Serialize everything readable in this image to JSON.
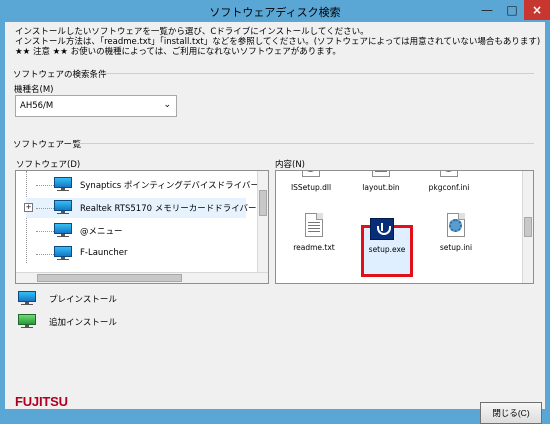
{
  "window": {
    "title": "ソフトウェアディスク検索",
    "minimize_icon": "—",
    "maximize_icon": "□",
    "close_icon": "×"
  },
  "intro": {
    "line1": "インストールしたいソフトウェアを一覧から選び、Cドライブにインストールしてください。",
    "line2": "インストール方法は、「readme.txt」「install.txt」などを参照してください。(ソフトウェアによっては用意されていない場合もあります)",
    "line3": "★★ 注意 ★★ お使いの機種によっては、ご利用になれないソフトウェアがあります。"
  },
  "search": {
    "group_title": "ソフトウェアの検索条件",
    "model_label": "機種名(M)",
    "model_value": "AH56/M",
    "dropdown_icon": "⌄"
  },
  "software": {
    "group_title": "ソフトウェア一覧",
    "list_label": "ソフトウェア(D)",
    "expand_icon": "+",
    "items": [
      {
        "label": "Synaptics ポインティングデバイスドライバー"
      },
      {
        "label": "Realtek RTS5170 メモリーカードドライバー"
      },
      {
        "label": "@メニュー"
      },
      {
        "label": "F-Launcher"
      }
    ]
  },
  "contents": {
    "label": "内容(N)",
    "files": [
      {
        "name": "ISSetup.dll",
        "icon": "dll-file-icon"
      },
      {
        "name": "layout.bin",
        "icon": "document-file-icon"
      },
      {
        "name": "pkgconf.ini",
        "icon": "settings-file-icon"
      },
      {
        "name": "readme.txt",
        "icon": "text-file-icon"
      },
      {
        "name": "setup.exe",
        "icon": "setup-exe-icon"
      },
      {
        "name": "setup.ini",
        "icon": "settings-file-icon"
      }
    ]
  },
  "legend": {
    "preinstall": "プレインストール",
    "additional": "追加インストール"
  },
  "footer": {
    "brand": "FUJITSU",
    "close_label": "閉じる(C)"
  },
  "colors": {
    "window_frame": "#5aa7d6",
    "close_button": "#c7372f",
    "selection_outline": "#e10f18"
  }
}
